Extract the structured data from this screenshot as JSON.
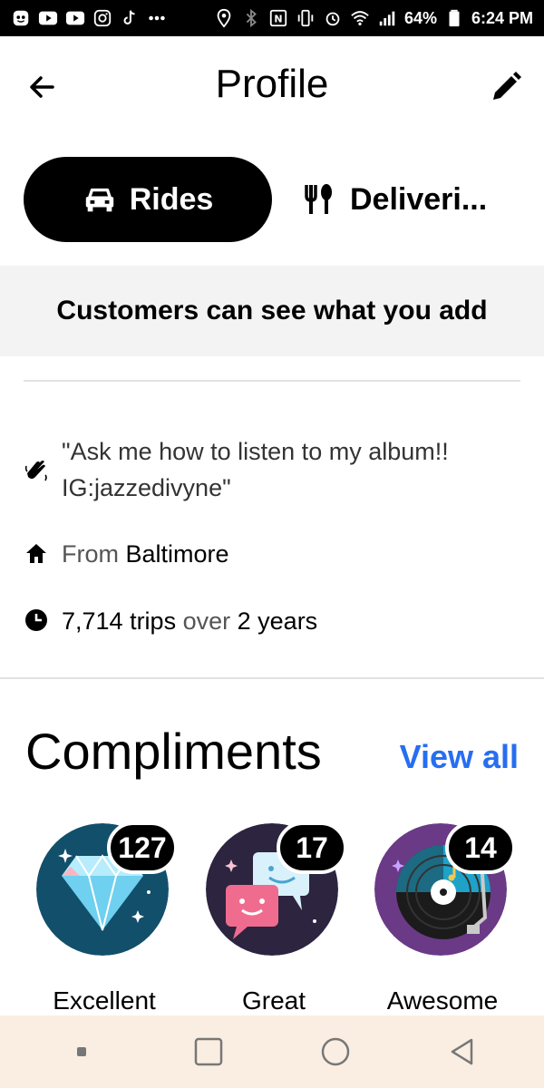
{
  "status_bar": {
    "battery": "64%",
    "time": "6:24 PM",
    "icons_left": [
      "shield-icon",
      "youtube-icon",
      "youtube-music-icon",
      "instagram-icon",
      "tiktok-icon",
      "more-dots-icon"
    ],
    "icons_right": [
      "location-icon",
      "bluetooth-icon",
      "nfc-icon",
      "vibrate-icon",
      "alarm-icon",
      "wifi-icon",
      "signal-icon",
      "battery-icon"
    ]
  },
  "header": {
    "title": "Profile"
  },
  "tabs": [
    {
      "label": "Rides",
      "active": true,
      "icon": "car-icon"
    },
    {
      "label": "Deliveri...",
      "active": false,
      "icon": "utensils-icon"
    }
  ],
  "banner": {
    "text": "Customers can see what you add"
  },
  "info": {
    "quote": "\"Ask me how to listen to my album!! IG:jazzedivyne\"",
    "from_prefix": "From",
    "from_value": "Baltimore",
    "trips_value": "7,714 trips",
    "trips_mid": "over",
    "trips_duration": "2 years"
  },
  "compliments": {
    "title": "Compliments",
    "view_all": "View all",
    "items": [
      {
        "label": "Excellent",
        "count": "127",
        "icon": "diamond-icon"
      },
      {
        "label": "Great",
        "count": "17",
        "icon": "chat-bubbles-icon"
      },
      {
        "label": "Awesome",
        "count": "14",
        "icon": "vinyl-record-icon"
      }
    ]
  },
  "colors": {
    "accent_link": "#276ef1",
    "nav_bg": "#faeee2",
    "banner_bg": "#f3f3f3"
  }
}
